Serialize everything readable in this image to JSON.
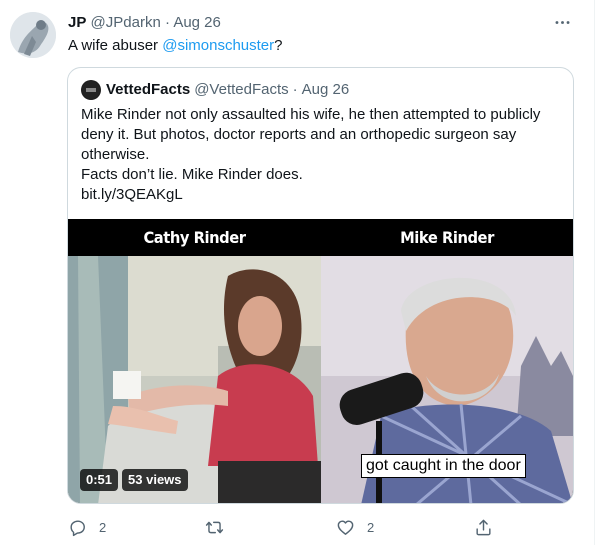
{
  "tweet": {
    "author": {
      "name": "JP",
      "handle": "@JPdarkn",
      "separator": "·",
      "date": "Aug 26"
    },
    "text_prefix": "A wife abuser ",
    "mention": "@simonschuster",
    "text_suffix": "?",
    "more_icon": "more-dots-icon"
  },
  "quote": {
    "author": {
      "name": "VettedFacts",
      "handle": "@VettedFacts",
      "separator": "·",
      "date": "Aug 26"
    },
    "lines": [
      "Mike Rinder not only assaulted his wife, he then attempted to publicly",
      "deny it. But photos, doctor reports and an orthopedic surgeon say",
      "otherwise.",
      "Facts don’t lie. Mike Rinder does.",
      "bit.ly/3QEAKgL"
    ],
    "media": {
      "left_title": "Cathy Rinder",
      "right_title": "Mike Rinder",
      "caption": "got caught in the door",
      "duration": "0:51",
      "views": "53 views"
    }
  },
  "actions": {
    "reply_count": "2",
    "retweet_count": "",
    "like_count": "2",
    "reply_icon": "reply-icon",
    "retweet_icon": "retweet-icon",
    "like_icon": "like-icon",
    "share_icon": "share-icon"
  },
  "colors": {
    "accent": "#1d9bf0",
    "muted": "#536471",
    "border": "#cfd9de"
  }
}
